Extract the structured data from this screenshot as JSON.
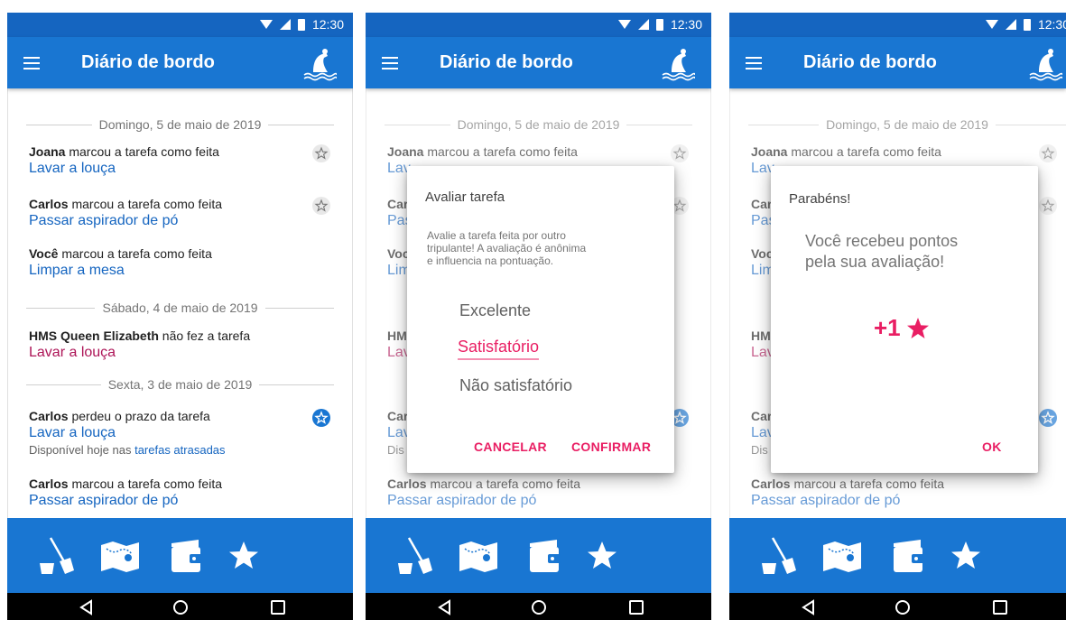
{
  "status": {
    "time": "12:30"
  },
  "app": {
    "title": "Diário de bordo"
  },
  "feed": {
    "date1": "Domingo, 5 de maio de 2019",
    "date2": "Sábado, 4 de maio de 2019",
    "date3": "Sexta, 3 de maio de 2019",
    "items": [
      {
        "actor": "Joana",
        "action": " marcou a tarefa como feita",
        "task": "Lavar a louça"
      },
      {
        "actor": "Carlos",
        "action": " marcou a tarefa como feita",
        "task": "Passar aspirador de pó"
      },
      {
        "actor": "Você",
        "action": " marcou a tarefa como feita",
        "task": "Limpar a mesa"
      },
      {
        "actor": "HMS Queen Elizabeth",
        "action": " não fez a tarefa",
        "task": "Lavar a louça"
      },
      {
        "actor": "Carlos",
        "action": " perdeu o prazo da tarefa",
        "task": "Lavar a louça",
        "sub_prefix": "Disponível hoje nas ",
        "sub_link": "tarefas atrasadas"
      },
      {
        "actor": "Carlos",
        "action": " marcou a tarefa como feita",
        "task": "Passar aspirador de pó"
      }
    ],
    "short": [
      "Lav",
      "Car",
      "Pas",
      "Voc",
      "Lim",
      "HM",
      "Lav",
      "Car",
      "Lav",
      "Dis"
    ]
  },
  "rating_dialog": {
    "title": "Avaliar tarefa",
    "body": [
      "Avalie a tarefa feita por outro",
      "tripulante! A avaliação é anônima",
      "e influencia na pontuação."
    ],
    "options": [
      "Excelente",
      "Satisfatório",
      "Não satisfatório"
    ],
    "selected_option": "Satisfatório",
    "cancel": "CANCELAR",
    "confirm": "CONFIRMAR"
  },
  "congrats_dialog": {
    "title": "Parabéns!",
    "message": [
      "Você recebeu pontos",
      "pela sua avaliação!"
    ],
    "points": "+1",
    "ok": "OK"
  },
  "colors": {
    "primary": "#1976d2",
    "status_bar": "#1565c0",
    "link": "#1565c0",
    "accent": "#e91e63",
    "missed": "#ad1457"
  },
  "icons": {
    "menu": "menu-icon",
    "logo": "ship-logo-icon",
    "nav": [
      "broom-icon",
      "map-icon",
      "wallet-icon",
      "star-icon"
    ],
    "system": [
      "back-icon",
      "home-icon",
      "recents-icon"
    ]
  }
}
